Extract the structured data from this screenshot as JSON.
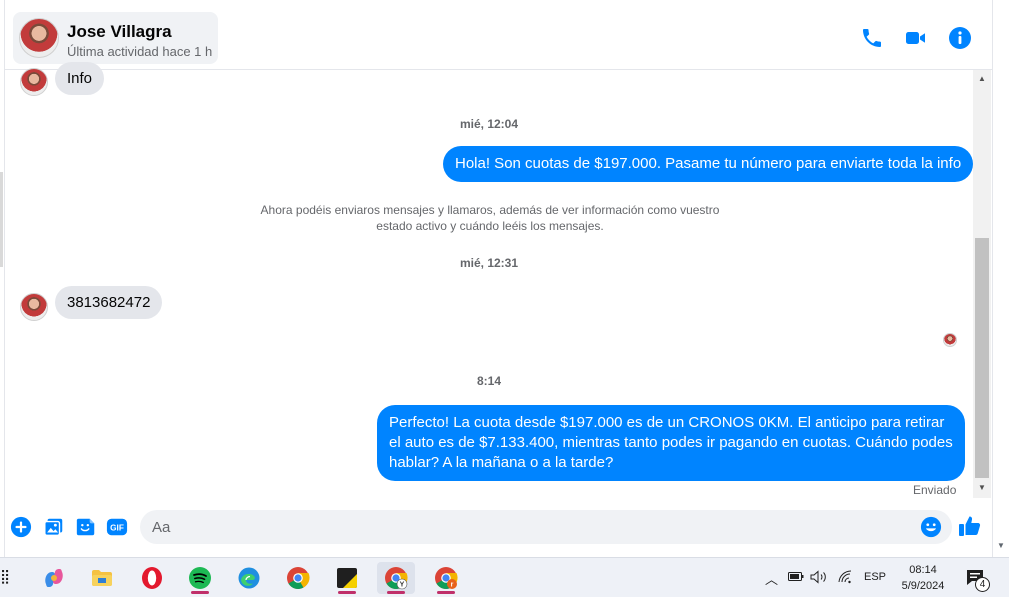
{
  "header": {
    "contact_name": "Jose Villagra",
    "contact_status": "Última actividad hace 1 h"
  },
  "chat": {
    "messages": [
      {
        "direction": "in",
        "text": "Info"
      },
      {
        "type": "timestamp",
        "text": "mié, 12:04"
      },
      {
        "direction": "out",
        "text": "Hola! Son cuotas de $197.000. Pasame tu número para enviarte toda la info"
      },
      {
        "type": "system",
        "text": "Ahora podéis enviaros mensajes y llamaros, además de ver información como vuestro estado activo y cuándo leéis los mensajes."
      },
      {
        "type": "timestamp",
        "text": "mié, 12:31"
      },
      {
        "direction": "in",
        "text": "3813682472"
      },
      {
        "type": "timestamp",
        "text": "8:14"
      },
      {
        "direction": "out",
        "text": "Perfecto! La cuota desde $197.000 es de un CRONOS 0KM. El anticipo para retirar el auto es de $7.133.400, mientras tanto podes ir pagando en cuotas. Cuándo podes hablar? A la mañana o a la tarde?"
      }
    ],
    "delivery_status": "Enviado"
  },
  "composer": {
    "placeholder": "Aa"
  },
  "taskbar": {
    "apps": [
      "copilot",
      "file-explorer",
      "opera",
      "spotify",
      "edge",
      "chrome",
      "sticky-notes",
      "chrome-profile-y",
      "chrome-profile-r"
    ],
    "language": "ESP",
    "time": "08:14",
    "date": "5/9/2024",
    "notification_count": "4"
  },
  "colors": {
    "accent": "#0084ff",
    "incoming_bubble": "#e4e6eb",
    "taskbar": "#eef1f7"
  }
}
